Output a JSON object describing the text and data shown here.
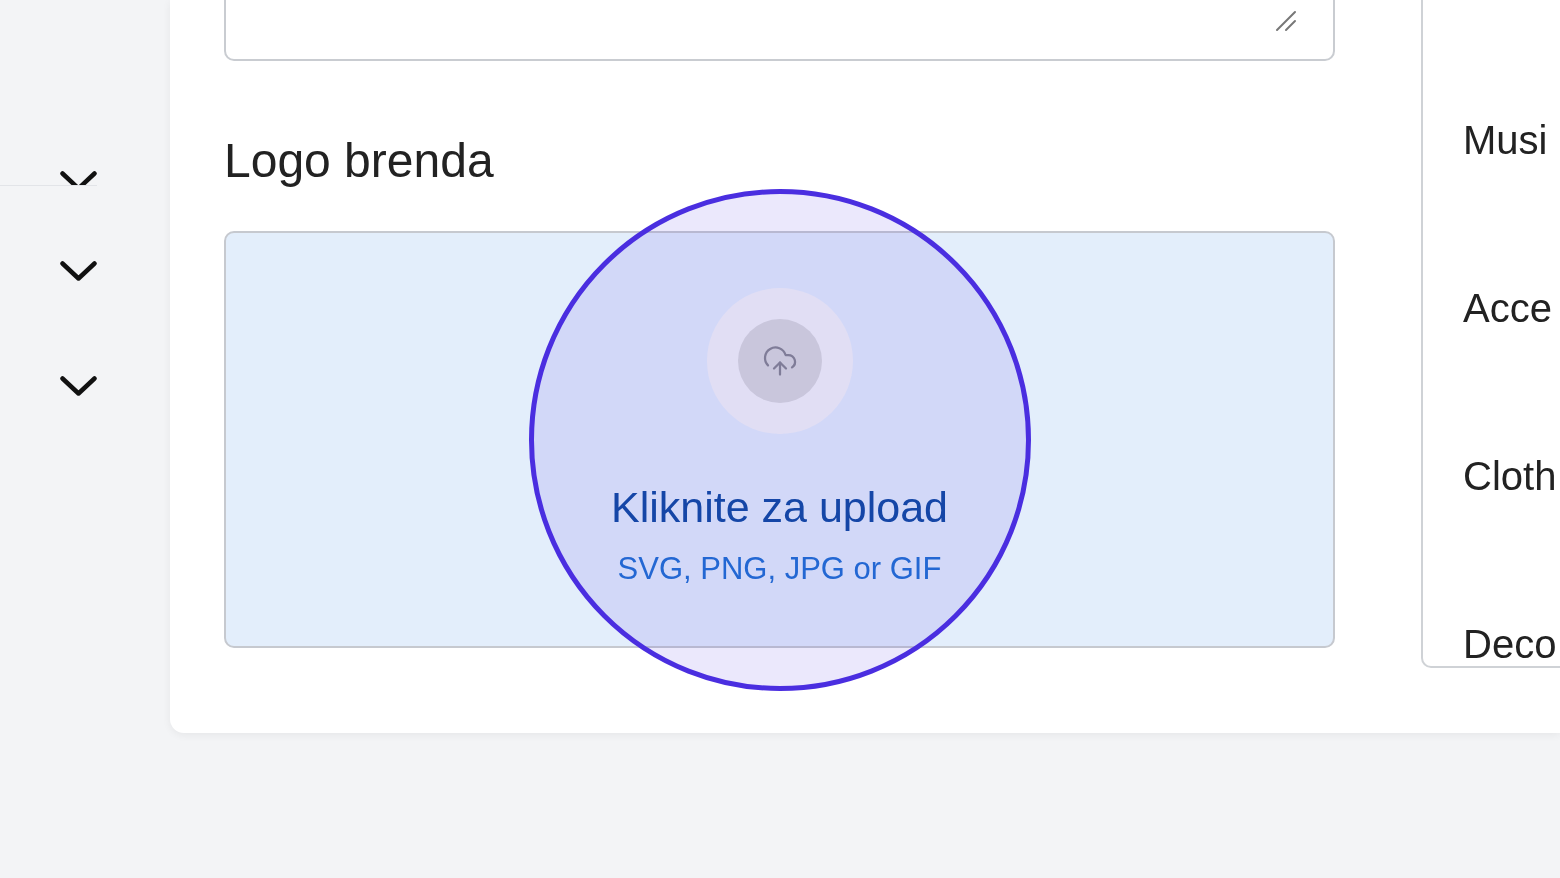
{
  "sidebar": {
    "sections": [
      {
        "expanded": false
      },
      {
        "expanded": false
      },
      {
        "expanded": false
      }
    ]
  },
  "form": {
    "logo_section": {
      "title": "Logo brenda",
      "upload": {
        "prompt": "Kliknite za upload",
        "formats": "SVG, PNG, JPG or GIF"
      }
    }
  },
  "category_list": {
    "items": [
      {
        "label": "Musi"
      },
      {
        "label": "Acce"
      },
      {
        "label": "Cloth"
      },
      {
        "label": "Deco"
      }
    ]
  }
}
